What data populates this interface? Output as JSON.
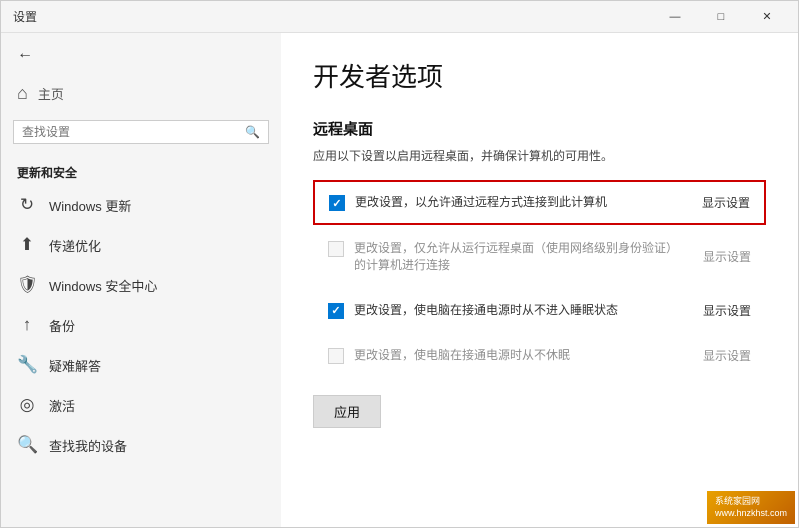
{
  "window": {
    "title": "设置",
    "controls": {
      "minimize": "—",
      "maximize": "□",
      "close": "✕"
    }
  },
  "sidebar": {
    "back_label": "后退",
    "home_icon": "⌂",
    "home_label": "主页",
    "search_placeholder": "查找设置",
    "section_label": "更新和安全",
    "items": [
      {
        "icon": "↻",
        "label": "Windows 更新",
        "name": "windows-update"
      },
      {
        "icon": "⬆",
        "label": "传递优化",
        "name": "delivery-optimization"
      },
      {
        "icon": "🛡",
        "label": "Windows 安全中心",
        "name": "windows-security"
      },
      {
        "icon": "↑",
        "label": "备份",
        "name": "backup"
      },
      {
        "icon": "🔑",
        "label": "疑难解答",
        "name": "troubleshoot"
      },
      {
        "icon": "◎",
        "label": "激活",
        "name": "activation"
      },
      {
        "icon": "🔍",
        "label": "查找我的设备",
        "name": "find-device"
      }
    ]
  },
  "main": {
    "title": "开发者选项",
    "remote_desktop_section": {
      "title": "远程桌面",
      "description": "应用以下设置以启用远程桌面，并确保计算机的可用性。",
      "options": [
        {
          "id": "opt1",
          "checked": true,
          "disabled": false,
          "highlighted": true,
          "text": "更改设置，以允许通过远程方式连接到此计算机",
          "link": "显示设置"
        },
        {
          "id": "opt2",
          "checked": false,
          "disabled": true,
          "highlighted": false,
          "text": "更改设置，仅允许从运行远程桌面（使用网络级别身份验证）的计算机进行连接",
          "link": "显示设置"
        },
        {
          "id": "opt3",
          "checked": true,
          "disabled": false,
          "highlighted": false,
          "text": "更改设置，使电脑在接通电源时从不进入睡眠状态",
          "link": "显示设置"
        },
        {
          "id": "opt4",
          "checked": false,
          "disabled": true,
          "highlighted": false,
          "text": "更改设置，使电脑在接通电源时从不休眠",
          "link": "显示设置"
        }
      ],
      "apply_button": "应用"
    }
  },
  "brand": {
    "line1": "系统家园网",
    "line2": "www.hnzkhst.com"
  }
}
